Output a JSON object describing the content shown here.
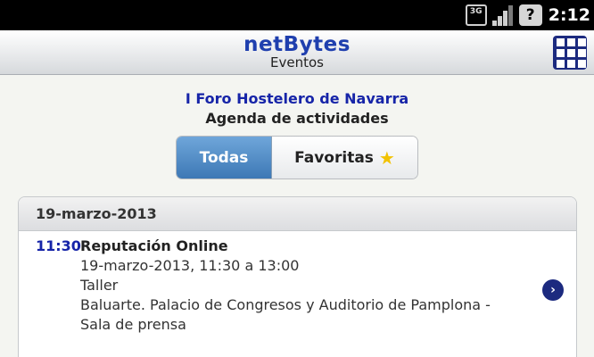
{
  "status_bar": {
    "network_label": "3G",
    "help_label": "?",
    "time": "2:12"
  },
  "header": {
    "brand": "netBytes",
    "subtitle": "Eventos",
    "menu_icon": "grid-icon"
  },
  "event": {
    "title": "I Foro Hostelero de Navarra",
    "subtitle": "Agenda de actividades"
  },
  "tabs": {
    "all": "Todas",
    "favorites": "Favoritas",
    "favorites_icon": "star-icon",
    "selected": "Todas"
  },
  "schedule": {
    "date": "19-marzo-2013",
    "items": [
      {
        "time": "11:30",
        "name": "Reputación Online",
        "when": "19-marzo-2013, 11:30 a 13:00",
        "type": "Taller",
        "location_line1": "Baluarte. Palacio de Congresos y Auditorio de Pamplona -",
        "location_line2": "Sala de prensa"
      }
    ]
  },
  "colors": {
    "brand_blue": "#1f3fae",
    "accent_blue": "#1624a8",
    "tab_selected": "#4f8cc9",
    "icon_navy": "#1c2a7f",
    "star": "#f2c200"
  }
}
